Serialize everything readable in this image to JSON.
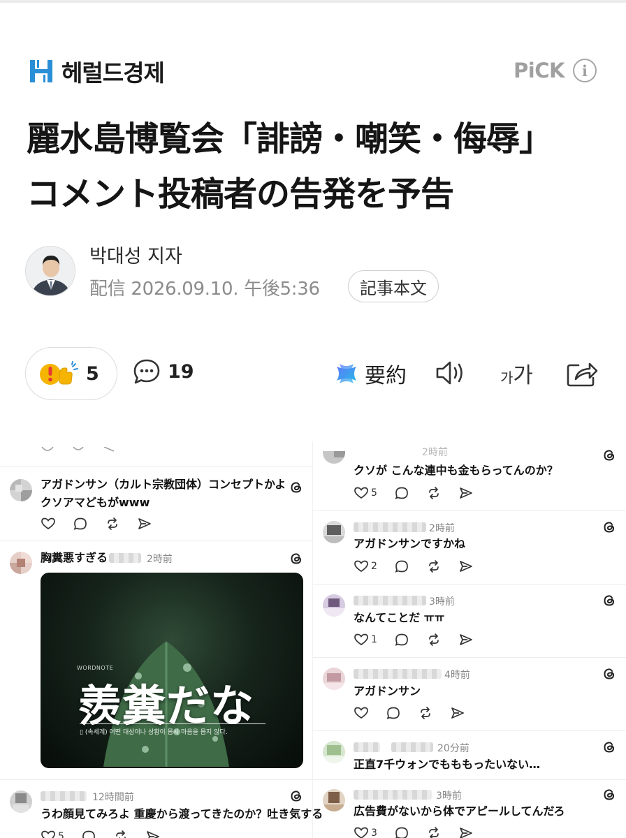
{
  "header": {
    "brand_name": "헤럴드경제",
    "pick_label": "PiCK",
    "info_glyph": "i"
  },
  "article": {
    "headline_lines": [
      "麗水島博覧会「誹謗・嘲笑・侮辱」",
      "コメント投稿者の告発を予告"
    ],
    "author": "박대성 지자",
    "published": "配信 2026.09.10. 午後5:36",
    "original_button": "記事本文"
  },
  "actions": {
    "reaction_count": "5",
    "comment_count": "19",
    "summary_label": "要約",
    "fontsize_small": "가",
    "fontsize_large": "가",
    "icons": [
      "reaction-emoji-icon",
      "comment-bubble-icon",
      "ai-summary-icon",
      "speaker-icon",
      "font-size-icon",
      "share-icon"
    ]
  },
  "embed": {
    "left_column": [
      {
        "text_lines": [
          "アガドンサン（カルト宗教団体）コンセプトかよ",
          "クソアマどもがwww"
        ]
      },
      {
        "text": "胸糞悪すぎる",
        "time": "2時前",
        "meme": {
          "brand": "WORDNOTE",
          "title": "羨糞だな",
          "subtitle": "▯ (속세계) 어떤 대상이나 상황이 몹시 마음을 몹지 않다."
        }
      },
      {
        "time": "12時間前",
        "text": "うわ顔見てみろよ 重慶から渡ってきたのか？吐き気する",
        "like_count": "5"
      }
    ],
    "right_column": [
      {
        "time": "2時前",
        "text": "クソが こんな連中も金もらってんのか？",
        "like_count": "5"
      },
      {
        "time": "2時前",
        "text": "アガドンサンですかね",
        "like_count": "2"
      },
      {
        "time": "3時前",
        "text": "なんてことだ ㅠㅠ",
        "like_count": "1"
      },
      {
        "time": "4時前",
        "text": "アガドンサン",
        "like_count": ""
      },
      {
        "time": "20分前",
        "text": "正直7千ウォンでもももったいない…",
        "like_count": ""
      },
      {
        "time": "3時前",
        "text": "広告費がないから体でアピールしてんだろ",
        "like_count": "3"
      }
    ]
  },
  "colors": {
    "brand_blue": "#2a8fd6",
    "pick_gray": "#a0a0a0",
    "summary_gradient": [
      "#5b7cfa",
      "#2bb6e8"
    ]
  }
}
